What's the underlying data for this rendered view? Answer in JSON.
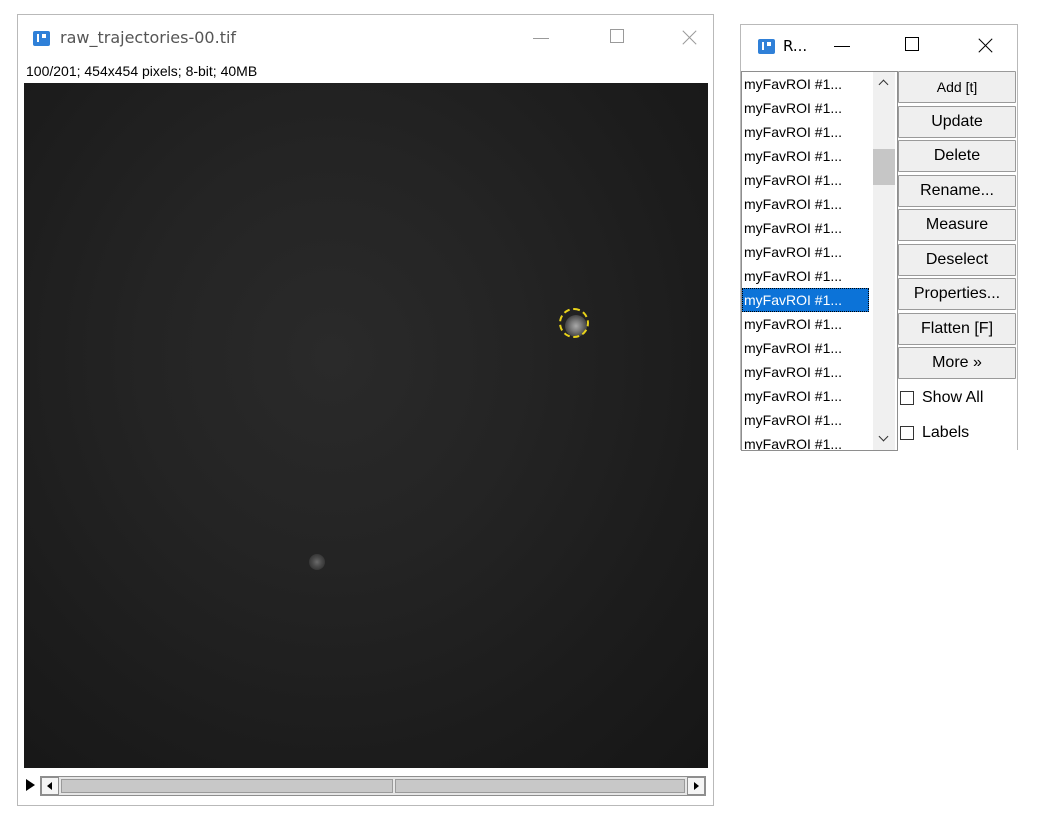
{
  "image_window": {
    "title": "raw_trajectories-00.tif",
    "info": "100/201; 454x454 pixels; 8-bit; 40MB"
  },
  "roi_manager": {
    "title": "R...",
    "items": [
      "myFavROI #1...",
      "myFavROI #1...",
      "myFavROI #1...",
      "myFavROI #1...",
      "myFavROI #1...",
      "myFavROI #1...",
      "myFavROI #1...",
      "myFavROI #1...",
      "myFavROI #1...",
      "myFavROI #1...",
      "myFavROI #1...",
      "myFavROI #1...",
      "myFavROI #1...",
      "myFavROI #1...",
      "myFavROI #1...",
      "myFavROI #1..."
    ],
    "selected_index": 9,
    "buttons": {
      "add": "Add [t]",
      "update": "Update",
      "delete": "Delete",
      "rename": "Rename...",
      "measure": "Measure",
      "deselect": "Deselect",
      "properties": "Properties...",
      "flatten": "Flatten [F]",
      "more": "More »"
    },
    "checkboxes": {
      "show_all": "Show All",
      "labels": "Labels"
    }
  },
  "colors": {
    "roi_outline": "#e8d21a",
    "selection": "#0c73d8",
    "app_icon": "#2f80d8"
  }
}
